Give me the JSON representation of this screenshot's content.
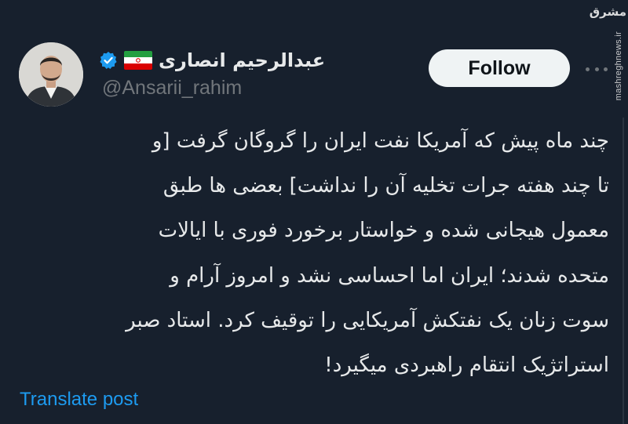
{
  "author": {
    "display_name": "عبدالرحیم انصاری",
    "handle": "@Ansarii_rahim",
    "verified_icon": "verified-badge-icon",
    "flag_icon": "iran-flag-icon",
    "avatar_icon": "profile-photo"
  },
  "actions": {
    "follow_label": "Follow",
    "more_icon": "more-options-icon"
  },
  "tweet": {
    "lines": [
      "چند ماه پیش که آمریکا نفت ایران را گروگان گرفت [و",
      "تا چند هفته جرات تخلیه آن را نداشت] بعضی ها طبق",
      "معمول هیجانی شده و خواستار برخورد فوری با ایالات",
      "متحده شدند؛ ایران اما احساسی نشد و امروز آرام و",
      "سوت زنان یک نفتکش آمریکایی را توقیف کرد. استاد صبر",
      "استراتژیک انتقام راهبردی میگیرد!"
    ],
    "translate_label": "Translate post"
  },
  "watermark": {
    "logo_text": "مشرق",
    "url": "mashreghnews.ir"
  },
  "colors": {
    "background": "#17202d",
    "text": "#e7e9ea",
    "secondary": "#71767b",
    "link": "#1d9bf0",
    "verified": "#1d9bf0",
    "button_bg": "#eff3f4"
  }
}
